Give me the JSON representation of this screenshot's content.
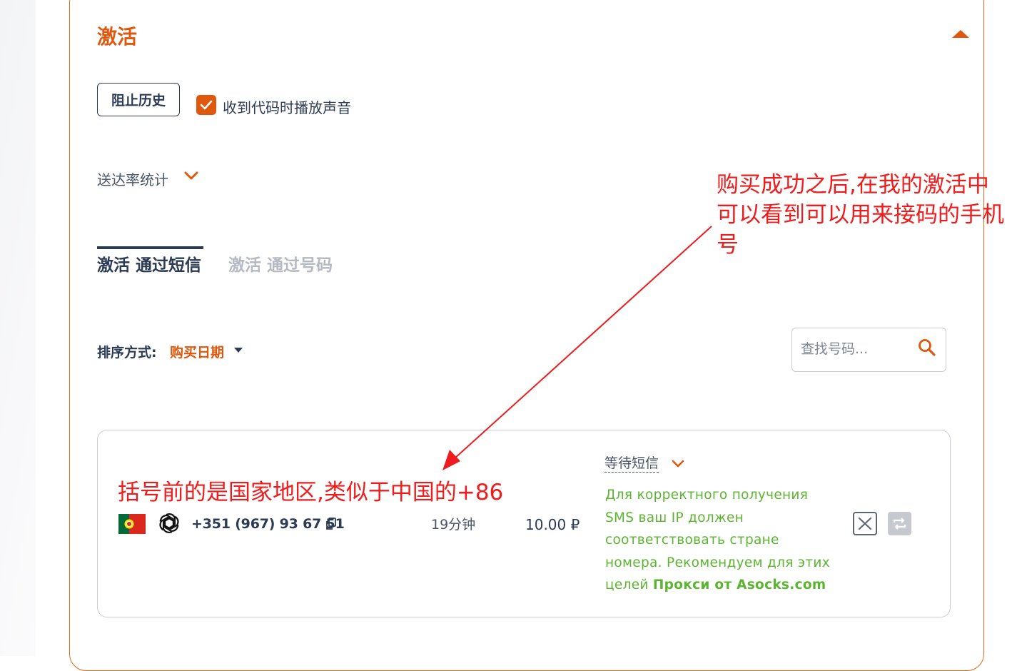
{
  "panel": {
    "title": "激活",
    "collapse_icon": "caret-up-icon"
  },
  "controls": {
    "block_history_label": "阻止历史",
    "sound_checkbox_checked": true,
    "sound_checkbox_label": "收到代码时播放声音"
  },
  "stats": {
    "label": "送达率统计",
    "icon": "chevron-down-icon"
  },
  "tabs": [
    {
      "label": "激活 通过短信",
      "active": true
    },
    {
      "label": "激活 通过号码",
      "active": false
    }
  ],
  "sort": {
    "label": "排序方式:",
    "value": "购买日期",
    "icon": "caret-down-icon"
  },
  "search": {
    "placeholder": "查找号码...",
    "value": "",
    "icon": "search-icon"
  },
  "activation": {
    "country_flag": "portugal-flag",
    "service_icon": "openai-icon",
    "phone": "+351 (967) 93 67 51",
    "copy_icon": "copy-icon",
    "time_left": "19分钟",
    "price": "10.00 ₽",
    "status": "等待短信",
    "status_icon": "chevron-down-icon",
    "notice_text": "Для корректного получения SMS ваш IP должен соответствовать стране номера. Рекомендуем для этих целей ",
    "notice_link": "Прокси от Asocks.com",
    "cancel_icon": "close-box-icon",
    "repeat_icon": "repeat-icon"
  },
  "annotations": {
    "top": "购买成功之后,在我的激活中可以看到可以用来接码的手机号",
    "bottom": "括号前的是国家地区,类似于中国的+86"
  },
  "colors": {
    "accent": "#e0570e",
    "text_primary": "#2b3a55",
    "notice_green": "#5cb531",
    "annotation_red": "#ee1c1c",
    "border": "#c9ccd2"
  }
}
